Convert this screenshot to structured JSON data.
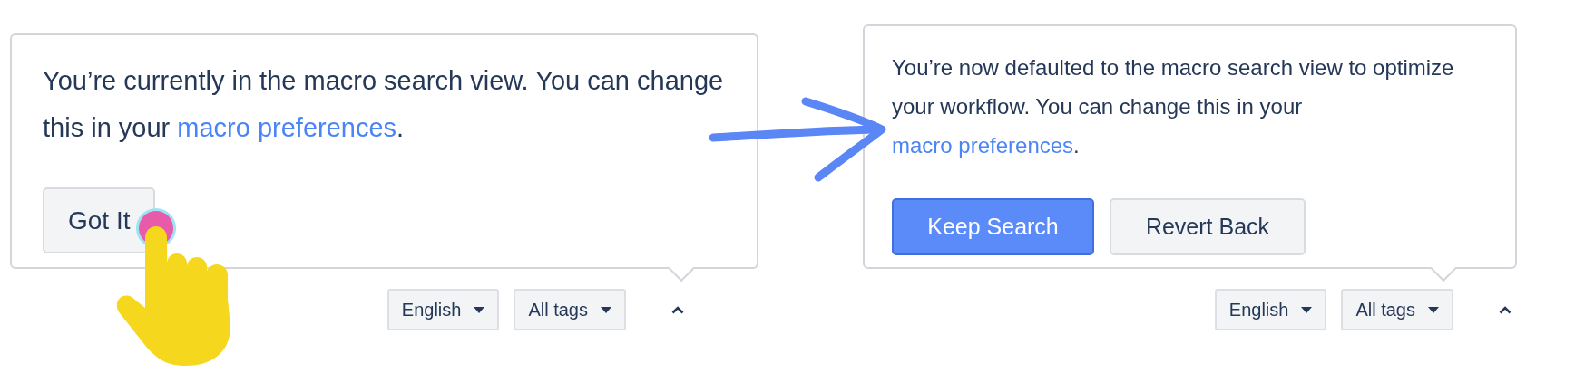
{
  "panels": [
    {
      "message_before": "You’re currently in the macro search view. You can change this in your ",
      "link": "macro preferences",
      "message_after": ".",
      "buttons": [
        {
          "label": "Got It",
          "kind": "secondary"
        }
      ],
      "filters": [
        {
          "label": "English"
        },
        {
          "label": "All tags"
        }
      ]
    },
    {
      "message_before": "You’re now defaulted to the macro search view to optimize your workflow. You can change this in your ",
      "link": "macro preferences",
      "message_after": ".",
      "buttons": [
        {
          "label": "Keep Search",
          "kind": "primary"
        },
        {
          "label": "Revert Back",
          "kind": "secondary"
        }
      ],
      "filters": [
        {
          "label": "English"
        },
        {
          "label": "All tags"
        }
      ]
    }
  ]
}
